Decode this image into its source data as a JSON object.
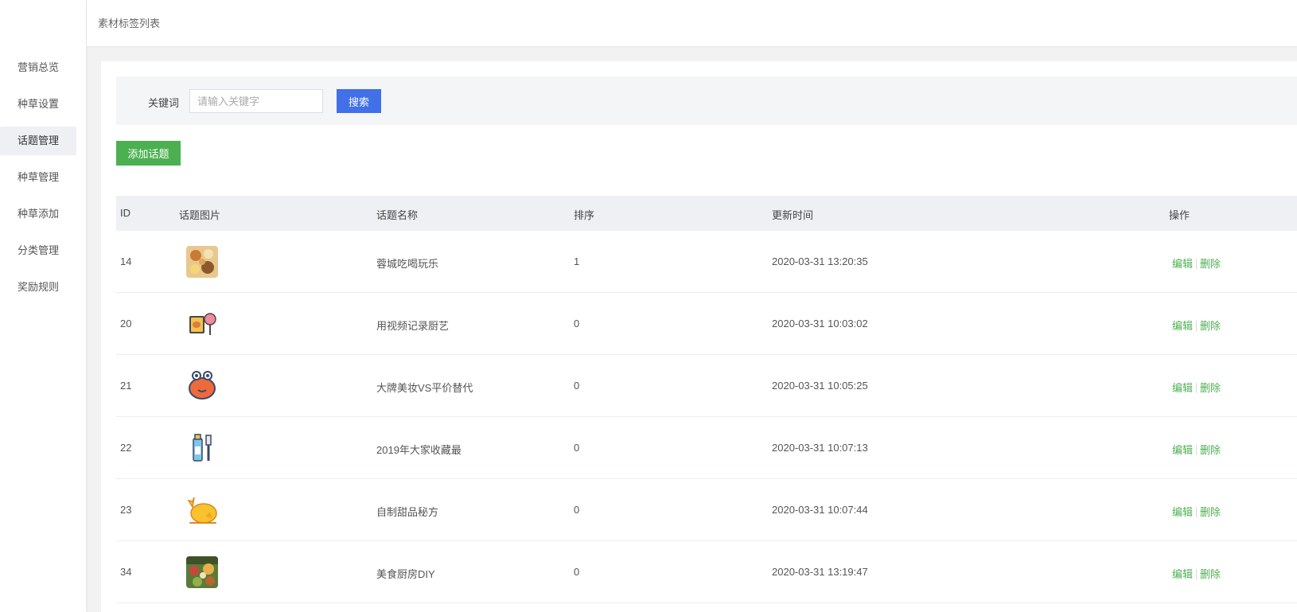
{
  "header": {
    "title": "素材标签列表"
  },
  "sidebar": {
    "items": [
      {
        "label": "营销总览"
      },
      {
        "label": "种草设置"
      },
      {
        "label": "话题管理"
      },
      {
        "label": "种草管理"
      },
      {
        "label": "种草添加"
      },
      {
        "label": "分类管理"
      },
      {
        "label": "奖励规则"
      }
    ],
    "active": "话题管理"
  },
  "search": {
    "label": "关键词",
    "placeholder": "请输入关键字",
    "value": "",
    "button": "搜索"
  },
  "add_button": "添加话题",
  "table": {
    "headers": {
      "id": "ID",
      "image": "话题图片",
      "name": "话题名称",
      "sort": "排序",
      "time": "更新时间",
      "ops": "操作"
    },
    "edit_label": "编辑",
    "delete_label": "删除",
    "rows": [
      {
        "id": "14",
        "name": "蓉城吃喝玩乐",
        "sort": "1",
        "time": "2020-03-31 13:20:35",
        "icon": "food-platter-icon"
      },
      {
        "id": "20",
        "name": "用视频记录厨艺",
        "sort": "0",
        "time": "2020-03-31 10:03:02",
        "icon": "candy-box-icon"
      },
      {
        "id": "21",
        "name": "大牌美妆VS平价替代",
        "sort": "0",
        "time": "2020-03-31 10:05:25",
        "icon": "crab-icon"
      },
      {
        "id": "22",
        "name": "2019年大家收藏最",
        "sort": "0",
        "time": "2020-03-31 10:07:13",
        "icon": "toothpaste-brush-icon"
      },
      {
        "id": "23",
        "name": "自制甜品秘方",
        "sort": "0",
        "time": "2020-03-31 10:07:44",
        "icon": "roast-chicken-icon"
      },
      {
        "id": "34",
        "name": "美食厨房DIY",
        "sort": "0",
        "time": "2020-03-31 13:19:47",
        "icon": "kitchen-food-icon"
      }
    ]
  },
  "colors": {
    "primary": "#4170e8",
    "success": "#4cb050",
    "sidebar_active": "#eef0f3"
  }
}
